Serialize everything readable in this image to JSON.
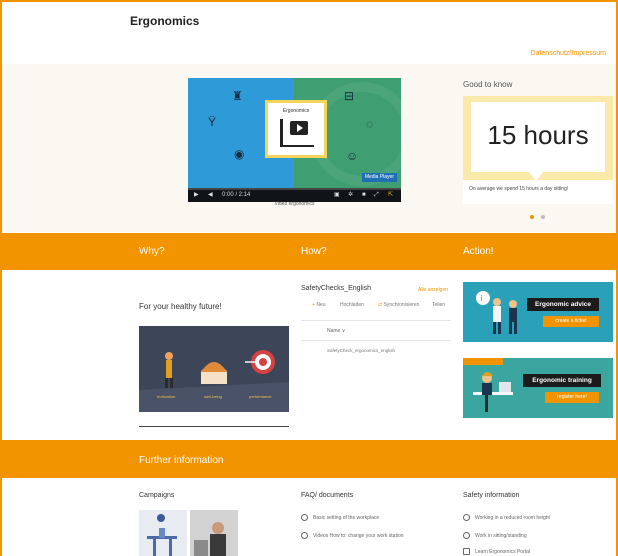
{
  "header": {
    "title": "Ergonomics",
    "edit_link": "Datenschutz/Impressum"
  },
  "video": {
    "card_title": "Ergonomics",
    "brand_badge": "Media Player",
    "time": "0:00 / 2:14",
    "caption": "Video ergonomics"
  },
  "good_to_know": {
    "title": "Good to know",
    "value": "15 hours",
    "text": "On average we spend 15 hours a day sitting!",
    "dots": 2,
    "active_dot": 0
  },
  "band1": {
    "why": "Why?",
    "how": "How?",
    "action": "Action!"
  },
  "why": {
    "title": "For your healthy future!",
    "img_labels": [
      "motivation",
      "well-being",
      "performance"
    ]
  },
  "how": {
    "title": "SafetyChecks_English",
    "all_link": "Alle anzeigen",
    "toolbar": [
      "Neu",
      "Hochladen",
      "Synchronisieren",
      "Teilen"
    ],
    "column": "Name",
    "file": "SafetyCheck_ergonomics_english"
  },
  "action": {
    "tile1_label": "Ergonomic advice",
    "tile1_button": "create a ticket",
    "tile2_label": "Ergonomic training",
    "tile2_button": "register here!"
  },
  "band2": {
    "title": "Further information"
  },
  "further": {
    "campaigns": "Campaigns",
    "faq": "FAQ/ documents",
    "faq_items": [
      "Basic setting of the workplace",
      "Videos How to: change your work station"
    ],
    "safety": "Safety information",
    "safety_items": [
      "Working in a reduced room height",
      "Work in sitting/standing",
      "Learn Ergonomics Portal"
    ]
  },
  "colors": {
    "brand_orange": "#f29400",
    "video_blue": "#2e9ad8",
    "video_green": "#3f9e72",
    "gtk_yellow": "#fbe9a9",
    "action_teal": "#2aa1b8"
  }
}
